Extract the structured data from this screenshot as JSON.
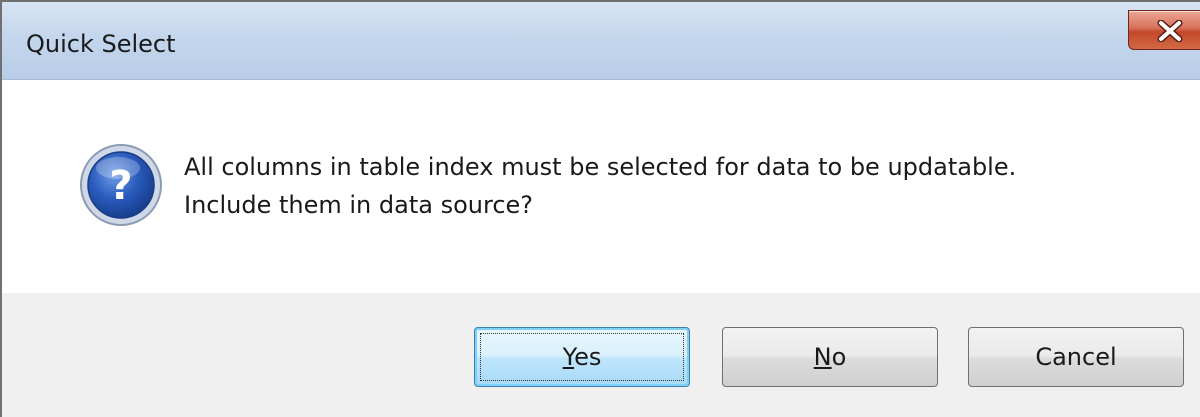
{
  "dialog": {
    "title": "Quick Select",
    "close_icon": "close-icon",
    "message_icon": "question-icon",
    "message_line1": "All columns in table index must be selected for data to be updatable.",
    "message_line2": "Include them in data source?"
  },
  "buttons": {
    "yes": {
      "accel": "Y",
      "rest": "es"
    },
    "no": {
      "accel": "N",
      "rest": "o"
    },
    "cancel": {
      "label": "Cancel"
    }
  },
  "colors": {
    "titlebar": "#c4d6ec",
    "close_button": "#c4472c",
    "footer": "#f0f0f0",
    "default_button_border": "#3c7fb1",
    "icon_blue": "#1f4fa8"
  }
}
